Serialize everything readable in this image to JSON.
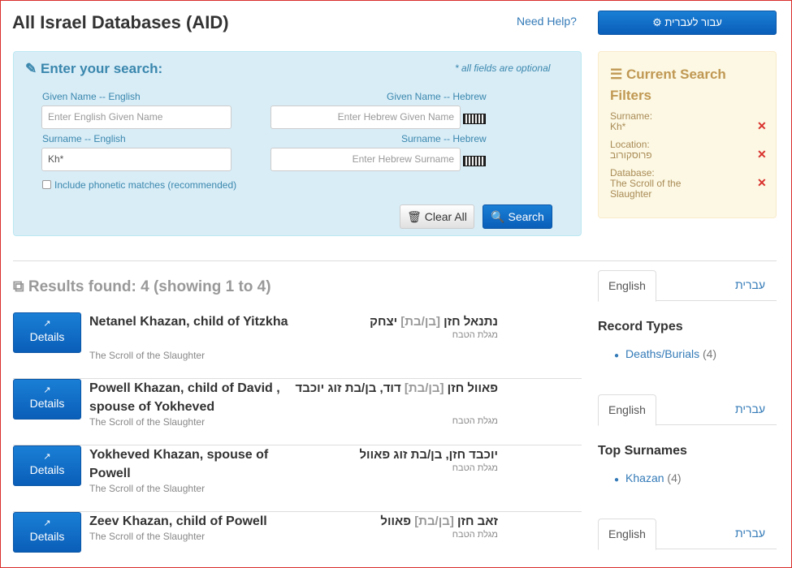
{
  "header": {
    "title": "All Israel Databases (AID)",
    "help_link": "Need Help?",
    "hebrew_button": "עבור לעברית",
    "hebrew_button_icon": "gear-icon"
  },
  "search": {
    "title": "Enter your search:",
    "optional_note": "* all fields are optional",
    "given_en_label": "Given Name -- English",
    "given_en_placeholder": "Enter English Given Name",
    "given_he_label": "Given Name -- Hebrew",
    "given_he_placeholder": "Enter Hebrew Given Name",
    "surname_en_label": "Surname -- English",
    "surname_en_value": "Kh*",
    "surname_he_label": "Surname -- Hebrew",
    "surname_he_placeholder": "Enter Hebrew Surname",
    "phonetic_label": "Include phonetic matches (recommended)",
    "phonetic_checked": false,
    "clear_label": "Clear All",
    "search_label": "Search"
  },
  "filters": {
    "title": "Current Search Filters",
    "items": [
      {
        "label": "Surname:",
        "value": "Kh*"
      },
      {
        "label": "Location:",
        "value": "פרוסקורוב"
      },
      {
        "label": "Database:",
        "value": "The Scroll of the Slaughter"
      }
    ]
  },
  "results": {
    "summary": "Results found: 4 (showing 1 to 4)",
    "details_label": "Details",
    "rows": [
      {
        "en_name": "Netanel Khazan, child of Yitzkha",
        "en_source": "The Scroll of the Slaughter",
        "he_pre": "נתנאל חזן ",
        "he_bracket": "[בן/בת]",
        "he_post": " יצחק",
        "he_source": "מגלת הטבח"
      },
      {
        "en_name": "Powell Khazan, child of David , spouse of Yokheved",
        "en_source": "The Scroll of the Slaughter",
        "he_pre": "פאוול חזן ",
        "he_bracket": "[בן/בת]",
        "he_post": " דוד, בן/בת זוג יוכבד",
        "he_source": "מגלת הטבח"
      },
      {
        "en_name": "Yokheved Khazan, spouse of Powell",
        "en_source": "The Scroll of the Slaughter",
        "he_pre": "יוכבד חזן, בן/בת זוג פאוול",
        "he_bracket": "",
        "he_post": "",
        "he_source": "מגלת הטבח"
      },
      {
        "en_name": "Zeev Khazan, child of Powell",
        "en_source": "The Scroll of the Slaughter",
        "he_pre": "זאב חזן ",
        "he_bracket": "[בן/בת]",
        "he_post": " פאוול",
        "he_source": "מגלת הטבח"
      }
    ]
  },
  "facets": {
    "tab_en": "English",
    "tab_he": "עברית",
    "record_types": {
      "title": "Record Types",
      "item": "Deaths/Burials",
      "count": "(4)"
    },
    "top_surnames": {
      "title": "Top Surnames",
      "item": "Khazan",
      "count": "(4)"
    }
  }
}
